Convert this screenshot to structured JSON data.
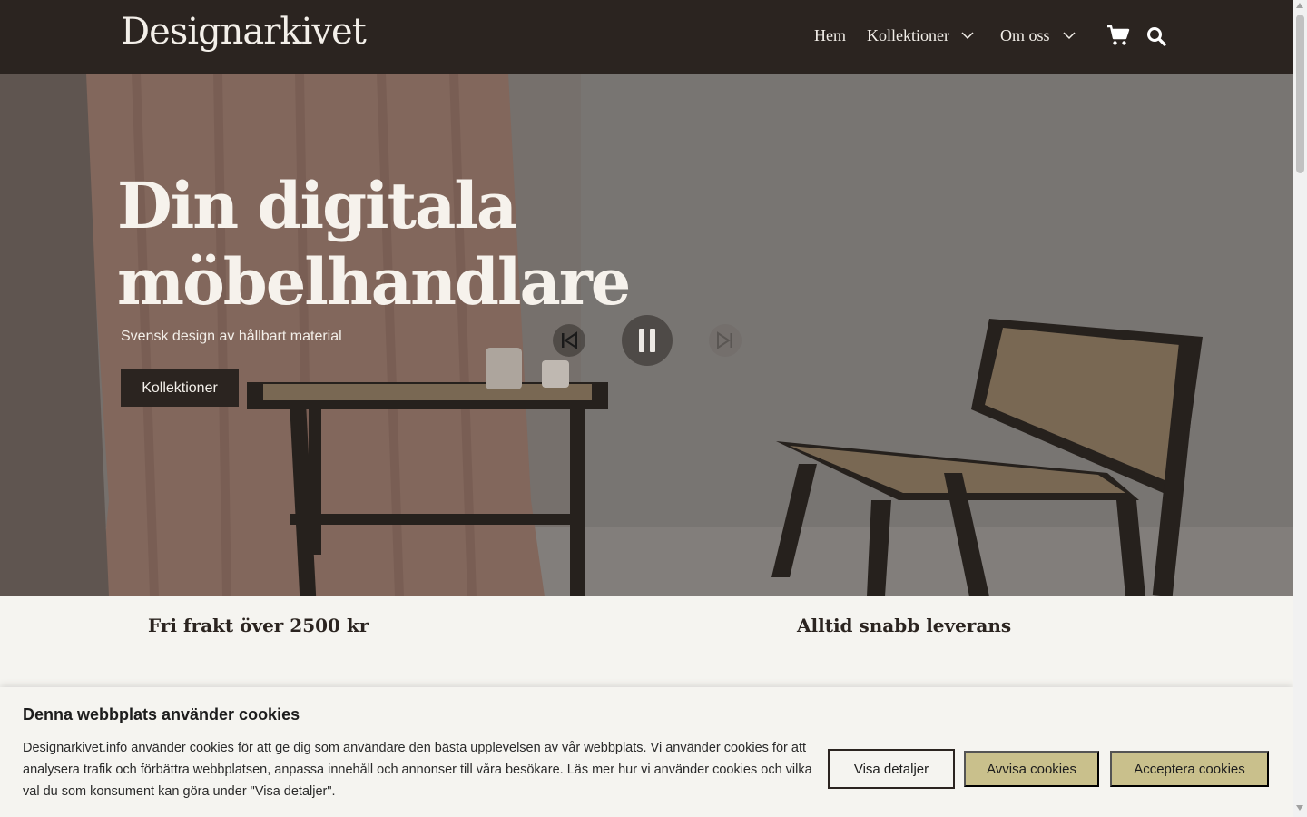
{
  "header": {
    "logo": "Designarkivet",
    "nav": {
      "home": "Hem",
      "collections": "Kollektioner",
      "about": "Om oss"
    },
    "icons": [
      "chevron-down-icon",
      "cart-icon",
      "search-icon"
    ]
  },
  "hero": {
    "title_line1": "Din digitala",
    "title_line2": "möbelhandlare",
    "subtitle": "Svensk design av hållbart material",
    "cta": "Kollektioner",
    "controls": [
      "previous-icon",
      "pause-icon",
      "next-icon"
    ]
  },
  "features": {
    "shipping": "Fri frakt över 2500 kr",
    "delivery": "Alltid snabb leverans"
  },
  "cookie": {
    "title": "Denna webbplats använder cookies",
    "text": "Designarkivet.info använder cookies för att ge dig som användare den bästa upplevelsen av vår webbplats. Vi använder cookies för att analysera trafik och förbättra webbplatsen, anpassa innehåll och annonser till våra besökare. Läs mer hur vi använder cookies och vilka val du som konsument kan göra under \"Visa detaljer\".",
    "details_btn": "Visa detaljer",
    "reject_btn": "Avvisa cookies",
    "accept_btn": "Acceptera cookies"
  },
  "colors": {
    "header_bg": "#2b2420",
    "page_bg": "#f5f4f0",
    "cookie_button": "#c9c08c"
  }
}
